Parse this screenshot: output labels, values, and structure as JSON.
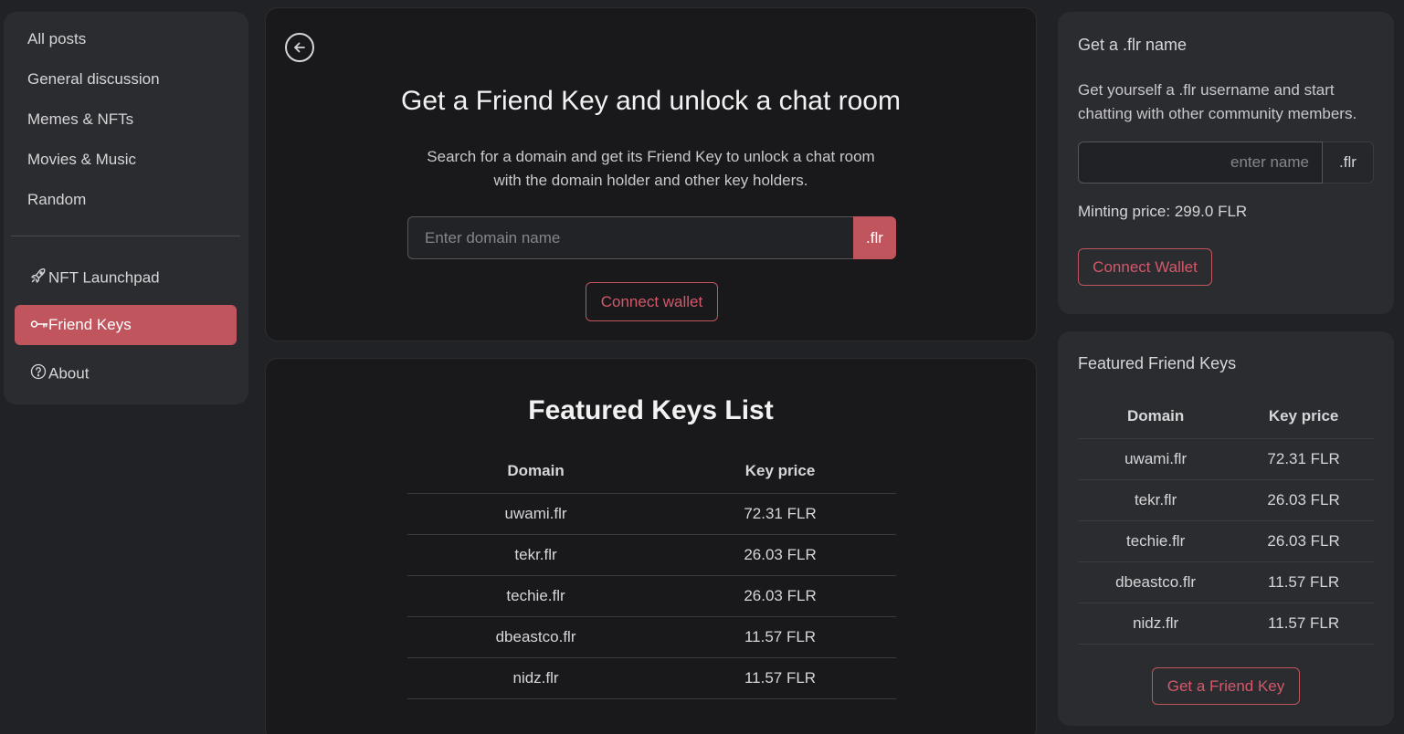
{
  "sidebar": {
    "items": [
      {
        "label": "All posts"
      },
      {
        "label": "General discussion"
      },
      {
        "label": "Memes & NFTs"
      },
      {
        "label": "Movies & Music"
      },
      {
        "label": "Random"
      }
    ],
    "launchpad": {
      "label": "NFT Launchpad",
      "icon": "rocket-icon"
    },
    "friend_keys": {
      "label": "Friend Keys",
      "icon": "key-icon"
    },
    "about": {
      "label": "About",
      "icon": "question-circle-icon"
    }
  },
  "hero": {
    "title": "Get a Friend Key and unlock a chat room",
    "subtitle": "Search for a domain and get its Friend Key to unlock a chat room with the domain holder and other key holders.",
    "input_placeholder": "Enter domain name",
    "tld": ".flr",
    "connect_label": "Connect wallet"
  },
  "featured_list": {
    "title": "Featured Keys List",
    "headers": [
      "Domain",
      "Key price"
    ],
    "rows": [
      [
        "uwami.flr",
        "72.31 FLR"
      ],
      [
        "tekr.flr",
        "26.03 FLR"
      ],
      [
        "techie.flr",
        "26.03 FLR"
      ],
      [
        "dbeastco.flr",
        "11.57 FLR"
      ],
      [
        "nidz.flr",
        "11.57 FLR"
      ]
    ]
  },
  "get_name": {
    "title": "Get a .flr name",
    "text": "Get yourself a .flr username and start chatting with other community members.",
    "input_placeholder": "enter name",
    "tld": ".flr",
    "minting_price": "Minting price: 299.0 FLR",
    "connect_label": "Connect Wallet"
  },
  "featured_side": {
    "title": "Featured Friend Keys",
    "headers": [
      "Domain",
      "Key price"
    ],
    "rows": [
      [
        "uwami.flr",
        "72.31 FLR"
      ],
      [
        "tekr.flr",
        "26.03 FLR"
      ],
      [
        "techie.flr",
        "26.03 FLR"
      ],
      [
        "dbeastco.flr",
        "11.57 FLR"
      ],
      [
        "nidz.flr",
        "11.57 FLR"
      ]
    ],
    "button_label": "Get a Friend Key"
  },
  "colors": {
    "accent": "#c0555e",
    "background": "#202226",
    "panel": "#19191b",
    "card": "#2b2c30"
  }
}
